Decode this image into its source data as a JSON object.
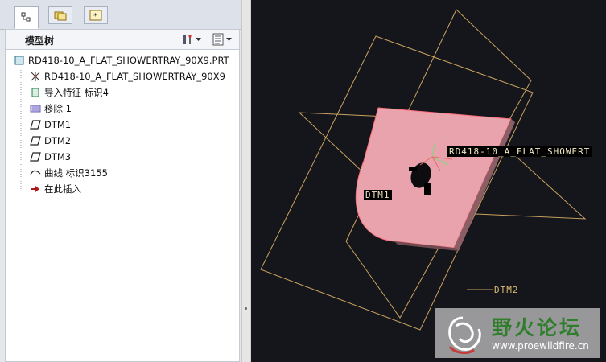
{
  "panel": {
    "title": "模型树"
  },
  "tree": {
    "root": "RD418-10_A_FLAT_SHOWERTRAY_90X9.PRT",
    "items": [
      {
        "label": "RD418-10_A_FLAT_SHOWERTRAY_90X9",
        "icon": "coordinate-system-icon"
      },
      {
        "label": "导入特征 标识4",
        "icon": "import-feature-icon"
      },
      {
        "label": "移除 1",
        "icon": "remove-feature-icon"
      },
      {
        "label": "DTM1",
        "icon": "datum-plane-icon"
      },
      {
        "label": "DTM2",
        "icon": "datum-plane-icon"
      },
      {
        "label": "DTM3",
        "icon": "datum-plane-icon"
      },
      {
        "label": "曲线 标识3155",
        "icon": "curve-icon"
      },
      {
        "label": "在此插入",
        "icon": "insert-here-arrow-icon"
      }
    ]
  },
  "viewport": {
    "csys_label": "RD418-10_A_FLAT_SHOWERT",
    "dtm1_label": "DTM1",
    "dtm2_label": "DTM2",
    "part_color": "#e8a3ad",
    "datum_color": "#c9a25e"
  },
  "watermark": {
    "name": "野火论坛",
    "url": "www.proewildfire.cn"
  }
}
